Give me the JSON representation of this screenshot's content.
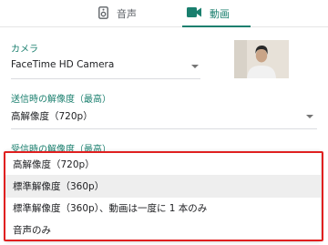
{
  "tabs": [
    {
      "label": "音声",
      "icon": "speaker-icon"
    },
    {
      "label": "動画",
      "icon": "video-camera-icon",
      "active": true
    }
  ],
  "camera": {
    "label": "カメラ",
    "value": "FaceTime HD Camera"
  },
  "send_resolution": {
    "label": "送信時の解像度（最高）",
    "value": "高解像度（720p）"
  },
  "receive_resolution": {
    "label": "受信時の解像度（最高）",
    "options": [
      "高解像度（720p）",
      "標準解像度（360p）",
      "標準解像度（360p）、動画は一度に 1 本のみ",
      "音声のみ"
    ],
    "selected_index": 1
  },
  "colors": {
    "accent": "#1a7f6e",
    "highlight": "#e02020"
  }
}
